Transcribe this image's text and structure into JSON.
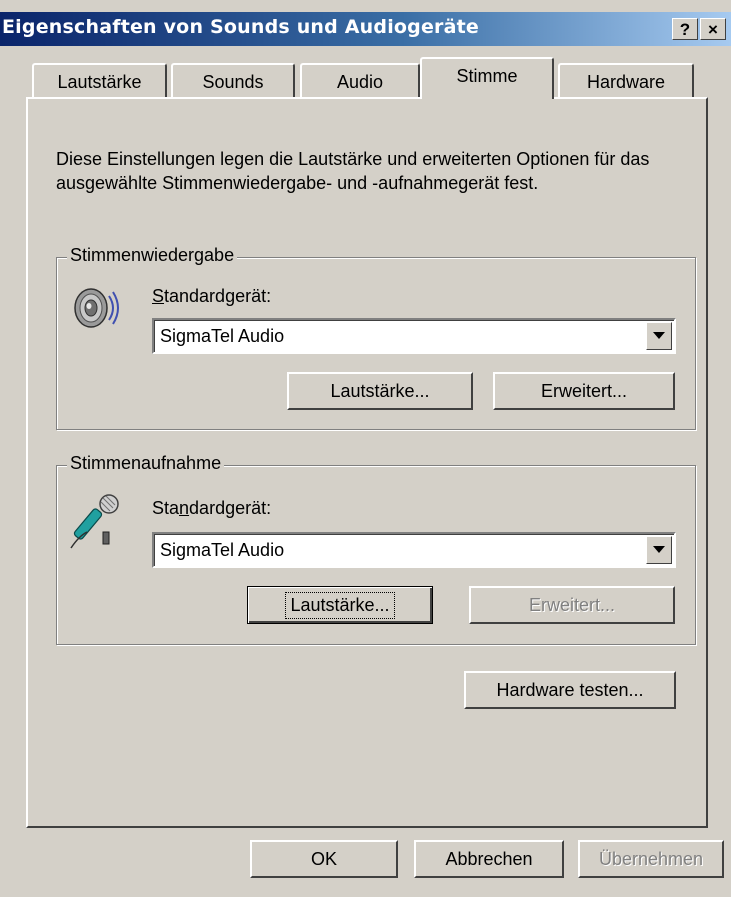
{
  "window": {
    "title": "Eigenschaften von Sounds und Audiogeräte",
    "help_button": "?",
    "close_button": "×"
  },
  "tabs": [
    {
      "label": "Lautstärke",
      "active": false
    },
    {
      "label": "Sounds",
      "active": false
    },
    {
      "label": "Audio",
      "active": false
    },
    {
      "label": "Stimme",
      "active": true
    },
    {
      "label": "Hardware",
      "active": false
    }
  ],
  "description": "Diese Einstellungen legen die Lautstärke und erweiterten Optionen für das ausgewählte Stimmenwiedergabe- und -aufnahmegerät fest.",
  "playback": {
    "legend": "Stimmenwiedergabe",
    "icon": "speaker-icon",
    "device_label": "Standardgerät:",
    "device_value": "SigmaTel Audio",
    "volume_button": "Lautstärke...",
    "advanced_button": "Erweitert..."
  },
  "recording": {
    "legend": "Stimmenaufnahme",
    "icon": "microphone-icon",
    "device_label": "Standardgerät:",
    "device_value": "SigmaTel Audio",
    "volume_button": "Lautstärke...",
    "advanced_button": "Erweitert..."
  },
  "test_hardware_button": "Hardware testen...",
  "footer": {
    "ok": "OK",
    "cancel": "Abbrechen",
    "apply": "Übernehmen"
  },
  "colors": {
    "face": "#d4d0c8",
    "title_start": "#0a246a",
    "title_end": "#a6caf0",
    "disabled_text": "#808080"
  }
}
